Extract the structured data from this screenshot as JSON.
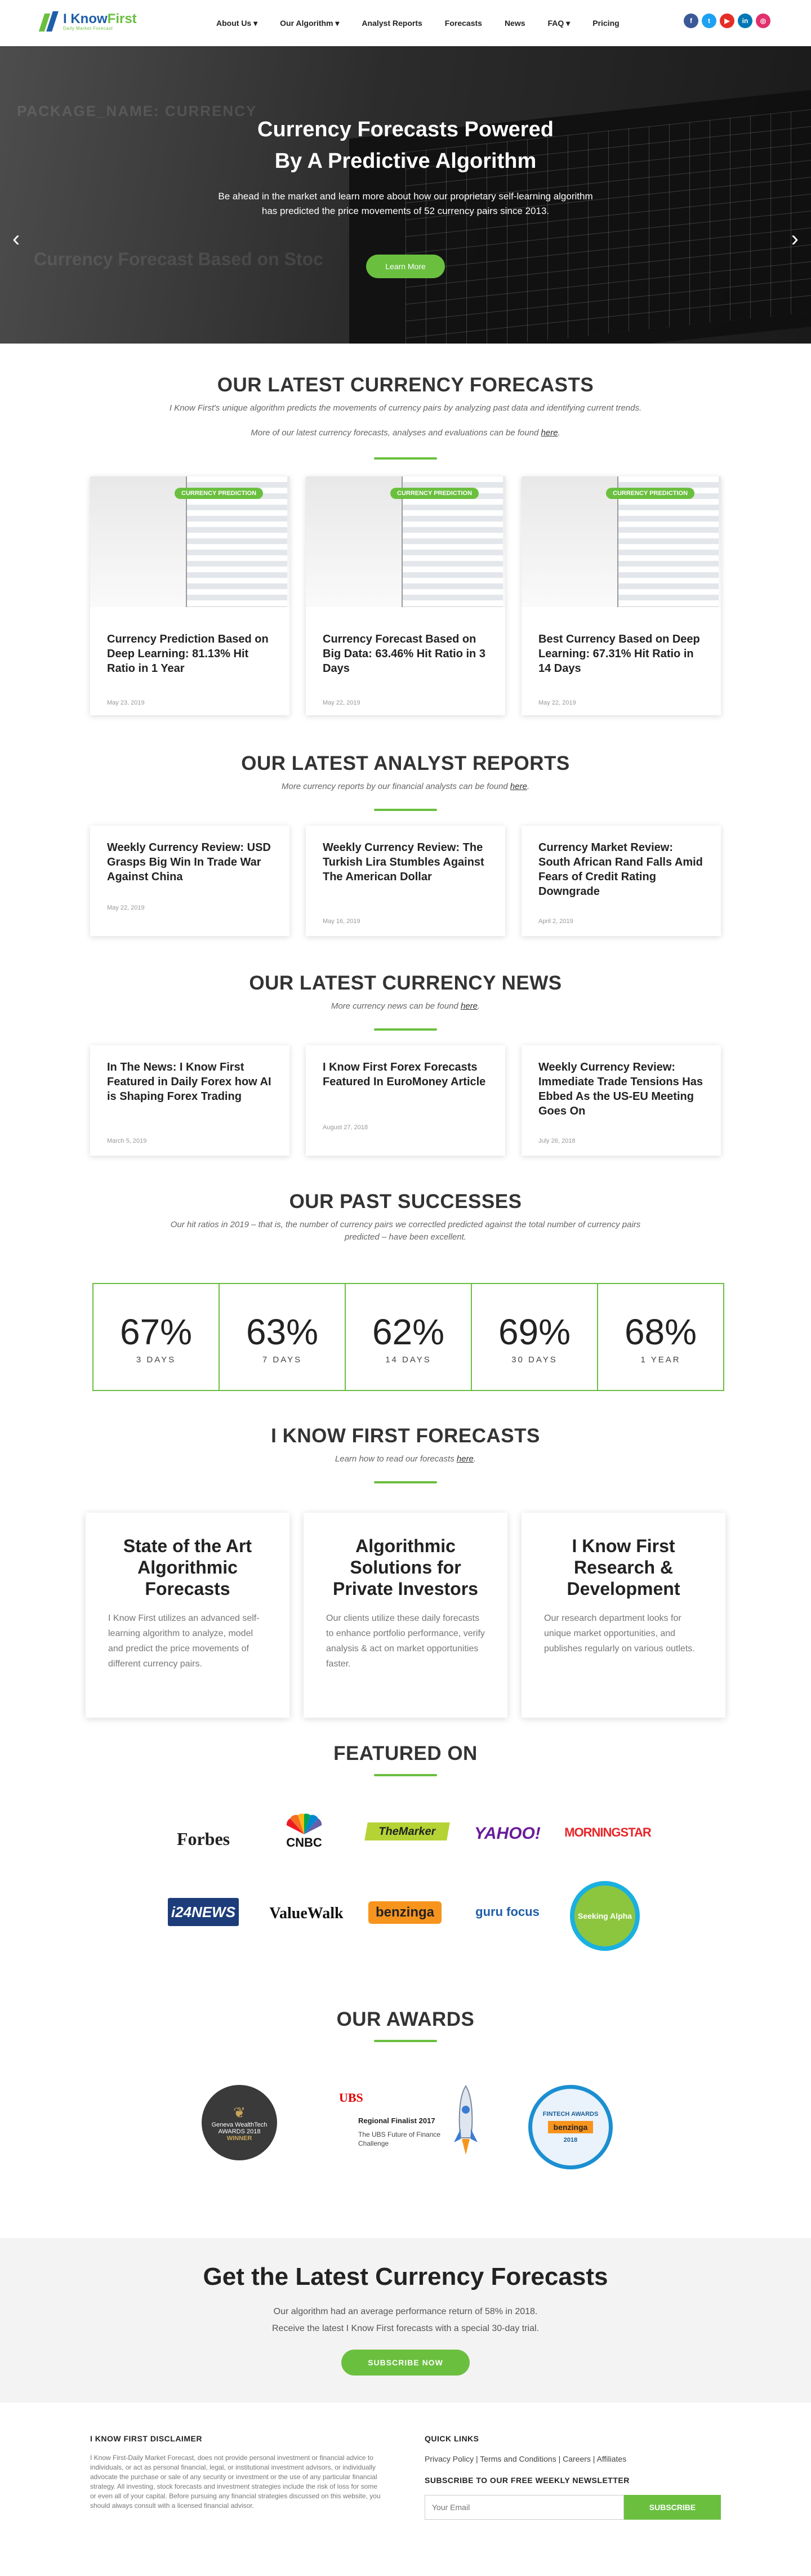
{
  "brand": {
    "logo_main": "I Know",
    "logo_accent": "First",
    "logo_sub": "Daily Market Forecast"
  },
  "nav": {
    "items": [
      "About Us ▾",
      "Our Algorithm ▾",
      "Analyst Reports",
      "Forecasts",
      "News",
      "FAQ ▾",
      "Pricing"
    ]
  },
  "social": [
    {
      "name": "facebook",
      "glyph": "f",
      "color": "#3b5998"
    },
    {
      "name": "twitter",
      "glyph": "t",
      "color": "#1da1f2"
    },
    {
      "name": "youtube",
      "glyph": "▶",
      "color": "#e52d27"
    },
    {
      "name": "linkedin",
      "glyph": "in",
      "color": "#0077b5"
    },
    {
      "name": "instagram",
      "glyph": "◎",
      "color": "#e1306c"
    }
  ],
  "hero": {
    "title": "Currency Forecasts Powered By A Predictive Algorithm",
    "text": "Be ahead in the market and learn more about how our proprietary self-learning algorithm has predicted the price movements of 52 currency pairs since 2013.",
    "button": "Learn More",
    "ghost1": "PACKAGE_NAME: CURRENCY",
    "ghost2": "Currency Forecast Based on Stoc",
    "prev": "‹",
    "next": "›"
  },
  "forecasts": {
    "title": "OUR LATEST CURRENCY FORECASTS",
    "sub1": "I Know First's unique algorithm predicts the movements of currency pairs by analyzing past data and identifying current trends.",
    "sub2": "More of our latest currency forecasts, analyses and evaluations can be found ",
    "sub2_link": "here",
    "sub2_end": ".",
    "cards": [
      {
        "badge": "CURRENCY PREDICTION",
        "title": "Currency Prediction Based on Deep Learning: 81.13% Hit Ratio in 1 Year",
        "date": "May 23, 2019"
      },
      {
        "badge": "CURRENCY PREDICTION",
        "title": "Currency Forecast Based on Big Data: 63.46% Hit Ratio in 3 Days",
        "date": "May 22, 2019"
      },
      {
        "badge": "CURRENCY PREDICTION",
        "title": "Best Currency Based on Deep Learning: 67.31% Hit Ratio in 14 Days",
        "date": "May 22, 2019"
      }
    ]
  },
  "reports": {
    "title": "OUR LATEST ANALYST REPORTS",
    "sub": "More currency reports by our financial analysts can be found ",
    "sub_link": "here",
    "sub_end": ".",
    "cards": [
      {
        "title": "Weekly Currency Review: USD Grasps Big Win In Trade War Against China",
        "date": "May 22, 2019"
      },
      {
        "title": "Weekly Currency Review: The Turkish Lira Stumbles Against The American Dollar",
        "date": "May 16, 2019"
      },
      {
        "title": "Currency Market Review: South African Rand Falls Amid Fears of Credit Rating Downgrade",
        "date": "April 2, 2019"
      }
    ]
  },
  "news": {
    "title": "OUR LATEST CURRENCY NEWS",
    "sub": "More currency news can be found ",
    "sub_link": "here",
    "sub_end": ".",
    "cards": [
      {
        "title": "In The News: I Know First Featured in Daily Forex how AI is Shaping Forex Trading",
        "date": "March 5, 2019"
      },
      {
        "title": "I Know First Forex Forecasts Featured In EuroMoney Article",
        "date": "August 27, 2018"
      },
      {
        "title": "Weekly Currency Review: Immediate Trade Tensions Has Ebbed As the US-EU Meeting Goes On",
        "date": "July 26, 2018"
      }
    ]
  },
  "successes": {
    "title": "OUR PAST SUCCESSES",
    "sub": "Our hit ratios in 2019 – that is, the number of currency pairs we correctled predicted against the total number of currency pairs predicted – have been excellent.",
    "stats": [
      {
        "value": "67%",
        "label": "3 DAYS"
      },
      {
        "value": "63%",
        "label": "7 DAYS"
      },
      {
        "value": "62%",
        "label": "14 DAYS"
      },
      {
        "value": "69%",
        "label": "30 DAYS"
      },
      {
        "value": "68%",
        "label": "1 YEAR"
      }
    ]
  },
  "ikf": {
    "title": "I KNOW FIRST FORECASTS",
    "sub": "Learn how to read our forecasts ",
    "sub_link": "here",
    "sub_end": ".",
    "cards": [
      {
        "title": "State of the Art Algorithmic Forecasts",
        "text": "I Know First utilizes an advanced self-learning algorithm to analyze, model and predict the price movements of different currency pairs."
      },
      {
        "title": "Algorithmic Solutions for Private Investors",
        "text": "Our clients utilize these daily forecasts to enhance portfolio performance, verify analysis & act on market opportunities faster."
      },
      {
        "title": "I Know First Research & Development",
        "text": "Our research department looks for unique market opportunities, and publishes regularly on various outlets."
      }
    ]
  },
  "featured": {
    "title": "FEATURED ON",
    "logos": [
      "Forbes",
      "CNBC",
      "TheMarker",
      "YAHOO!",
      "MORNINGSTAR",
      "i24NEWS",
      "ValueWalk",
      "benzinga",
      "guru focus",
      "Seeking Alpha"
    ]
  },
  "awards": {
    "title": "OUR AWARDS",
    "items": [
      {
        "l1": "Geneva WealthTech",
        "l2": "AWARDS 2018",
        "l3": "WINNER"
      },
      {
        "l1": "UBS",
        "l2": "Regional Finalist 2017",
        "l3": "The UBS Future of Finance Challenge"
      },
      {
        "l1": "FINTECH AWARDS",
        "l2": "benzinga",
        "l3": "2018"
      }
    ]
  },
  "cta": {
    "title": "Get the Latest Currency Forecasts",
    "line1": "Our algorithm had an average performance return of 58% in 2018.",
    "line2": "Receive the latest I Know First forecasts with a special 30-day trial.",
    "button": "SUBSCRIBE NOW"
  },
  "footer": {
    "disclaimer_title": "I KNOW FIRST DISCLAIMER",
    "disclaimer": "I Know First-Daily Market Forecast, does not provide personal investment or financial advice to individuals, or act as personal financial, legal, or institutional investment advisors, or individually advocate the purchase or sale of any security or investment or the use of any particular financial strategy. All investing, stock forecasts and investment strategies include the risk of loss for some or even all of your capital. Before pursuing any financial strategies discussed on this website, you should always consult with a licensed financial advisor.",
    "quick_title": "QUICK LINKS",
    "quick_links": "Privacy Policy | Terms and Conditions | Careers | Affiliates",
    "newsletter_title": "SUBSCRIBE TO OUR FREE WEEKLY NEWSLETTER",
    "email_placeholder": "Your Email",
    "subscribe": "SUBSCRIBE"
  },
  "colors": {
    "accent": "#6abf3f",
    "brand_blue": "#1f5ea8"
  }
}
